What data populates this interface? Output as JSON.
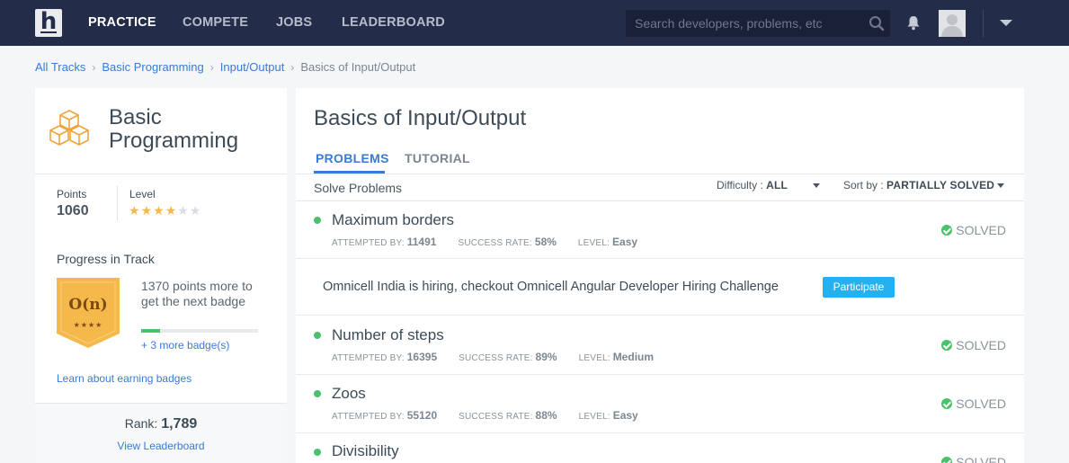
{
  "nav": {
    "logo_letter": "h",
    "items": [
      "PRACTICE",
      "COMPETE",
      "JOBS",
      "LEADERBOARD"
    ],
    "search_placeholder": "Search developers, problems, etc",
    "icons": [
      "search-icon",
      "bell-icon",
      "avatar",
      "chevron-down-icon"
    ]
  },
  "breadcrumb": {
    "links": [
      "All Tracks",
      "Basic Programming",
      "Input/Output"
    ],
    "current": "Basics of Input/Output"
  },
  "track": {
    "title": "Basic Programming",
    "points_label": "Points",
    "points": "1060",
    "level_label": "Level",
    "level": 4,
    "level_max": 6,
    "progress_title": "Progress in Track",
    "badge_text": "O(n)",
    "badge_stars": "★★★★",
    "next_badge": "1370 points more to get the next badge",
    "badge_progress": 0.16,
    "more_badges": "+ 3 more badge(s)",
    "learn": "Learn about earning badges",
    "rank_label": "Rank: ",
    "rank": "1,789",
    "view_leaderboard": "View Leaderboard"
  },
  "main": {
    "title": "Basics of Input/Output",
    "tabs": [
      "PROBLEMS",
      "TUTORIAL"
    ],
    "solve_label": "Solve Problems",
    "difficulty_label": "Difficulty : ",
    "difficulty_value": "ALL",
    "sort_label": "Sort by : ",
    "sort_value": "PARTIALLY SOLVED",
    "attempted_label": "ATTEMPTED BY:",
    "success_label": "SUCCESS RATE:",
    "level_label": "LEVEL:",
    "problems": [
      {
        "name": "Maximum borders",
        "attempted": "11491",
        "success": "58%",
        "level": "Easy",
        "status": "SOLVED"
      },
      {
        "name": "Number of steps",
        "attempted": "16395",
        "success": "89%",
        "level": "Medium",
        "status": "SOLVED"
      },
      {
        "name": "Zoos",
        "attempted": "55120",
        "success": "88%",
        "level": "Easy",
        "status": "SOLVED"
      },
      {
        "name": "Divisibility",
        "attempted": "",
        "success": "",
        "level": "",
        "status": "SOLVED"
      }
    ],
    "promo_text": "Omnicell India is hiring, checkout Omnicell Angular Developer Hiring Challenge",
    "promo_button": "Participate"
  },
  "colors": {
    "nav_bg": "#232c48",
    "accent": "#3a7bd5",
    "success": "#4ac26b",
    "participate": "#25b0f0",
    "badge": "#f5b84b"
  }
}
